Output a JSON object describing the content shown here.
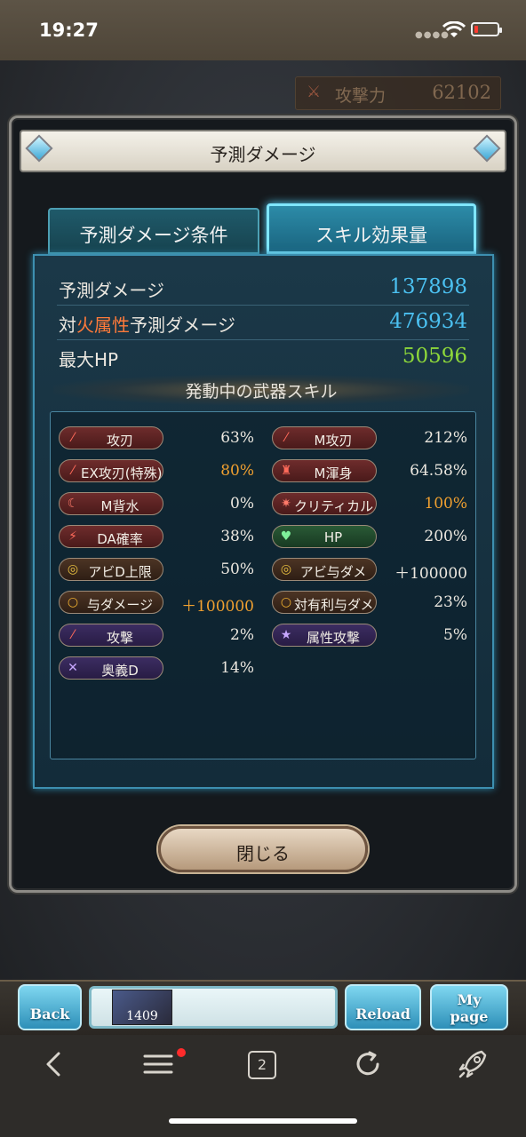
{
  "status_bar": {
    "time": "19:27"
  },
  "background": {
    "stat_label": "攻撃力",
    "stat_value": "62102"
  },
  "dialog": {
    "title": "予測ダメージ",
    "tabs": [
      {
        "label": "予測ダメージ条件",
        "active": false
      },
      {
        "label": "スキル効果量",
        "active": true
      }
    ],
    "damage_rows": {
      "predicted": {
        "label": "予測ダメージ",
        "value": "137898",
        "color": "#4bc0f0"
      },
      "vs_fire": {
        "label_prefix": "対",
        "label_element": "火属性",
        "label_suffix": "予測ダメージ",
        "value": "476934",
        "color": "#4bc0f0"
      },
      "max_hp": {
        "label": "最大HP",
        "value": "50596",
        "color": "#8ed83a"
      }
    },
    "skills_title": "発動中の武器スキル",
    "skills_left": [
      {
        "name": "攻刃",
        "value": "63%",
        "icon": "sword-icon",
        "style": "red",
        "highlight": false
      },
      {
        "name": "EX攻刃(特殊)",
        "value": "80%",
        "icon": "sword-icon",
        "style": "red",
        "highlight": true
      },
      {
        "name": "M背水",
        "value": "0%",
        "icon": "moon-icon",
        "style": "red",
        "highlight": false
      },
      {
        "name": "DA確率",
        "value": "38%",
        "icon": "double-strike-icon",
        "style": "red",
        "highlight": false
      },
      {
        "name": "アビD上限",
        "value": "50%",
        "icon": "ability-icon",
        "style": "gold",
        "highlight": false
      },
      {
        "name": "与ダメージ",
        "value": "＋100000",
        "icon": "ring-icon",
        "style": "gold",
        "highlight": true
      },
      {
        "name": "攻撃",
        "value": "2%",
        "icon": "sword-icon",
        "style": "purple",
        "highlight": false
      },
      {
        "name": "奥義D",
        "value": "14%",
        "icon": "cross-icon",
        "style": "purple",
        "highlight": false
      }
    ],
    "skills_right": [
      {
        "name": "M攻刃",
        "value": "212%",
        "icon": "sword-icon",
        "style": "red",
        "highlight": false
      },
      {
        "name": "M渾身",
        "value": "64.58%",
        "icon": "flex-icon",
        "style": "red",
        "highlight": false
      },
      {
        "name": "クリティカル",
        "value": "100%",
        "icon": "burst-icon",
        "style": "red",
        "highlight": true
      },
      {
        "name": "HP",
        "value": "200%",
        "icon": "heart-icon",
        "style": "green",
        "highlight": false
      },
      {
        "name": "アビ与ダメ",
        "value": "＋100000",
        "icon": "ability-icon",
        "style": "gold",
        "highlight": false
      },
      {
        "name": "対有利与ダメ",
        "value": "23%",
        "icon": "ring-icon",
        "style": "gold",
        "highlight": false
      },
      {
        "name": "属性攻撃",
        "value": "5%",
        "icon": "star-icon",
        "style": "purple",
        "highlight": false
      }
    ],
    "close_label": "閉じる"
  },
  "game_bar": {
    "back_label": "Back",
    "reload_label": "Reload",
    "mypage_line1": "My",
    "mypage_line2": "page",
    "thumb_number": "1409"
  },
  "browser_toolbar": {
    "tab_count": "2"
  }
}
